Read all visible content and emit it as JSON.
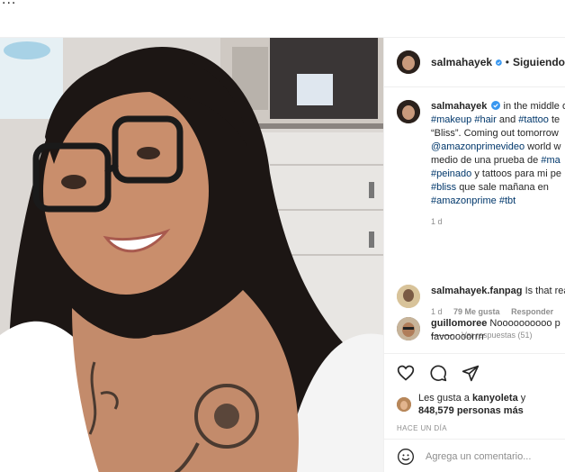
{
  "top_partial_text": "...",
  "post": {
    "username": "salmahayek",
    "separator": "•",
    "follow_label": "Siguiendo"
  },
  "caption": {
    "username": "salmahayek",
    "line1": "in the middle o",
    "tag_makeup": "#makeup",
    "tag_hair": "#hair",
    "and_word": "and",
    "tag_tattoo": "#tattoo",
    "after_tattoo": "te",
    "line3": "“Bliss”. Coming out tomorrow",
    "mention": "@amazonprimevideo",
    "after_mention": "world w",
    "line5_pre": "medio de una prueba de",
    "tag_ma": "#ma",
    "tag_peinado": "#peinado",
    "line6_rest": "y tattoos para mi pe",
    "tag_bliss": "#bliss",
    "line7_rest": "que sale mañana en",
    "tag_amazonprime": "#amazonprime",
    "tag_tbt": "#tbt",
    "age": "1 d"
  },
  "comments": [
    {
      "username": "salmahayek.fanpag",
      "text": "Is that rea",
      "age": "1 d",
      "likes": "79 Me gusta",
      "reply_label": "Responder"
    },
    {
      "username": "guillomoree",
      "text": "Noooooooooo p",
      "text2": "favooooorrrr"
    }
  ],
  "view_replies": "Ver respuestas (51)",
  "likes": {
    "prefix": "Les gusta a",
    "user": "kanyoleta",
    "suffix": "y",
    "count": "848,579 personas más"
  },
  "timestamp": "HACE UN DÍA",
  "comment_placeholder": "Agrega un comentario...",
  "icons": [
    "heart-icon",
    "comment-icon",
    "share-icon",
    "emoji-icon",
    "verified-icon"
  ],
  "colors": {
    "link": "#00376b",
    "verified": "#3897f0",
    "muted": "#8e8e8e",
    "text": "#262626"
  }
}
